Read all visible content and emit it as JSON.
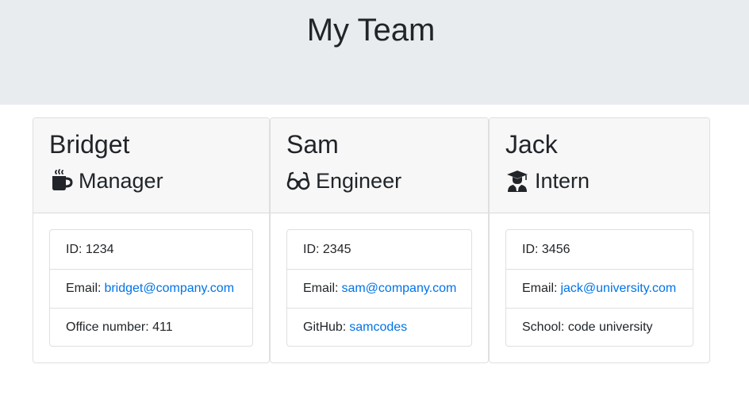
{
  "page": {
    "title": "My Team"
  },
  "team": [
    {
      "name": "Bridget",
      "role": "Manager",
      "icon": "coffee-icon",
      "details": [
        {
          "label": "ID: 1234"
        },
        {
          "label": "Email:",
          "link": "bridget@company.com"
        },
        {
          "label": "Office number: 411"
        }
      ]
    },
    {
      "name": "Sam",
      "role": "Engineer",
      "icon": "glasses-icon",
      "details": [
        {
          "label": "ID: 2345"
        },
        {
          "label": "Email:",
          "link": "sam@company.com"
        },
        {
          "label": "GitHub:",
          "link": "samcodes"
        }
      ]
    },
    {
      "name": "Jack",
      "role": "Intern",
      "icon": "graduate-icon",
      "details": [
        {
          "label": "ID: 3456"
        },
        {
          "label": "Email:",
          "link": "jack@university.com"
        },
        {
          "label": "School: code university"
        }
      ]
    }
  ],
  "colors": {
    "link": "#0073e6",
    "header_bg": "#e9ecef",
    "card_header_bg": "#f7f7f7"
  }
}
